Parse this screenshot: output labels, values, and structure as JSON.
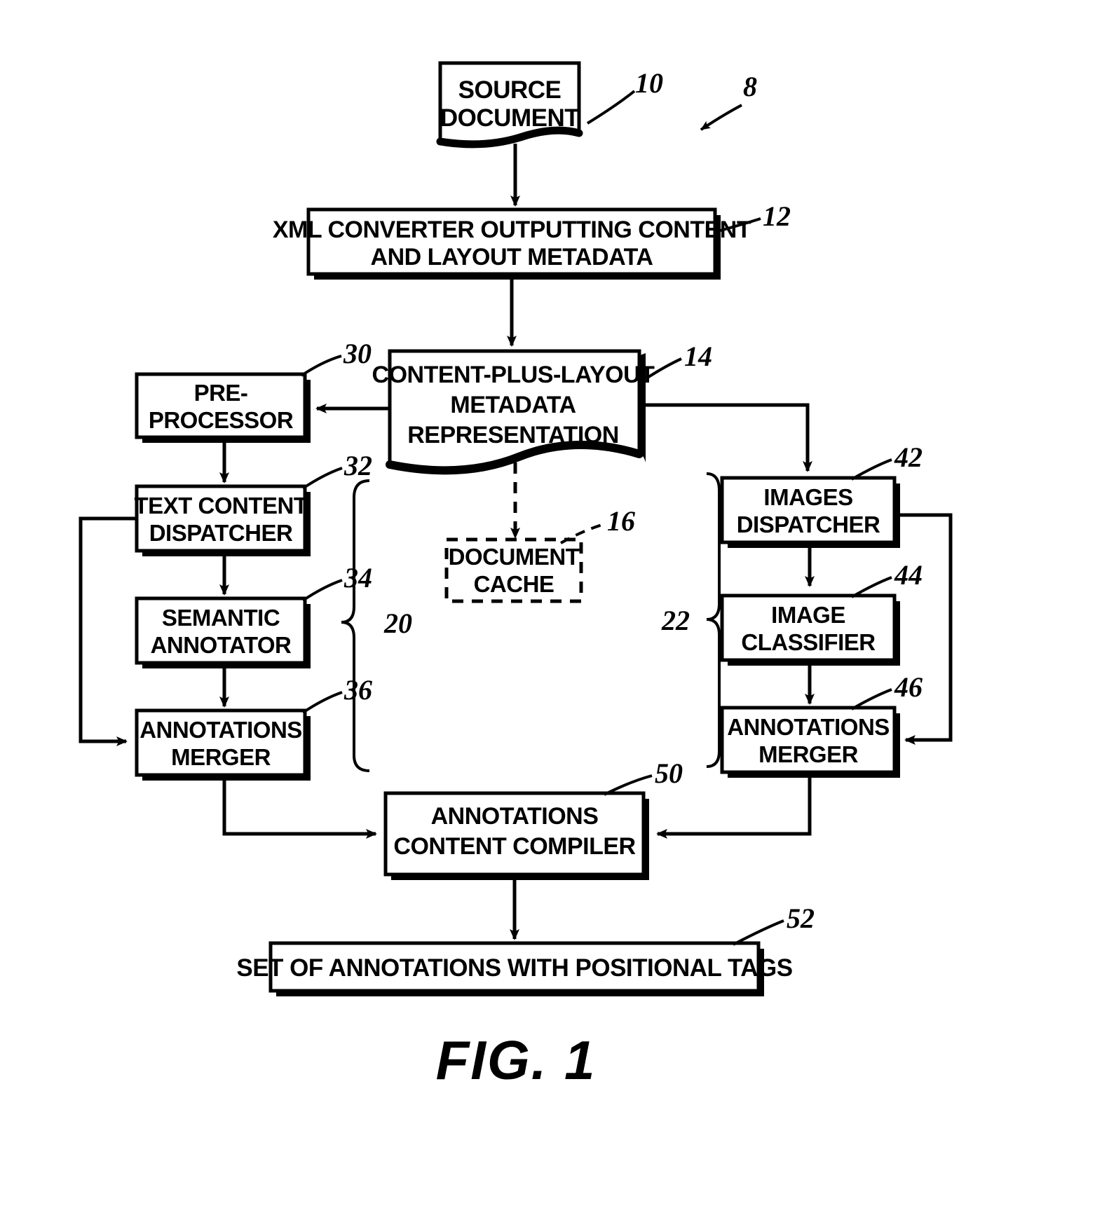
{
  "figure": {
    "caption": "FIG. 1",
    "system_ref": "8"
  },
  "nodes": {
    "source_document": {
      "line1": "SOURCE",
      "line2": "DOCUMENT",
      "ref": "10"
    },
    "xml_converter": {
      "line1": "XML CONVERTER OUTPUTTING CONTENT",
      "line2": "AND LAYOUT METADATA",
      "ref": "12"
    },
    "content_plus_layout": {
      "line1": "CONTENT-PLUS-LAYOUT",
      "line2": "METADATA",
      "line3": "REPRESENTATION",
      "ref": "14"
    },
    "document_cache": {
      "line1": "DOCUMENT",
      "line2": "CACHE",
      "ref": "16"
    },
    "pre_processor": {
      "line1": "PRE-",
      "line2": "PROCESSOR",
      "ref": "30"
    },
    "text_content_dispatcher": {
      "line1": "TEXT CONTENT",
      "line2": "DISPATCHER",
      "ref": "32"
    },
    "semantic_annotator": {
      "line1": "SEMANTIC",
      "line2": "ANNOTATOR",
      "ref": "34"
    },
    "annotations_merger_text": {
      "line1": "ANNOTATIONS",
      "line2": "MERGER",
      "ref": "36"
    },
    "images_dispatcher": {
      "line1": "IMAGES",
      "line2": "DISPATCHER",
      "ref": "42"
    },
    "image_classifier": {
      "line1": "IMAGE",
      "line2": "CLASSIFIER",
      "ref": "44"
    },
    "annotations_merger_images": {
      "line1": "ANNOTATIONS",
      "line2": "MERGER",
      "ref": "46"
    },
    "annotations_content_compiler": {
      "line1": "ANNOTATIONS",
      "line2": "CONTENT COMPILER",
      "ref": "50"
    },
    "set_of_annotations": {
      "line1": "SET OF ANNOTATIONS WITH POSITIONAL TAGS",
      "ref": "52"
    }
  },
  "groups": {
    "text_pipeline": {
      "ref": "20"
    },
    "image_pipeline": {
      "ref": "22"
    }
  },
  "colors": {
    "ink": "#000000",
    "paper": "#ffffff"
  }
}
